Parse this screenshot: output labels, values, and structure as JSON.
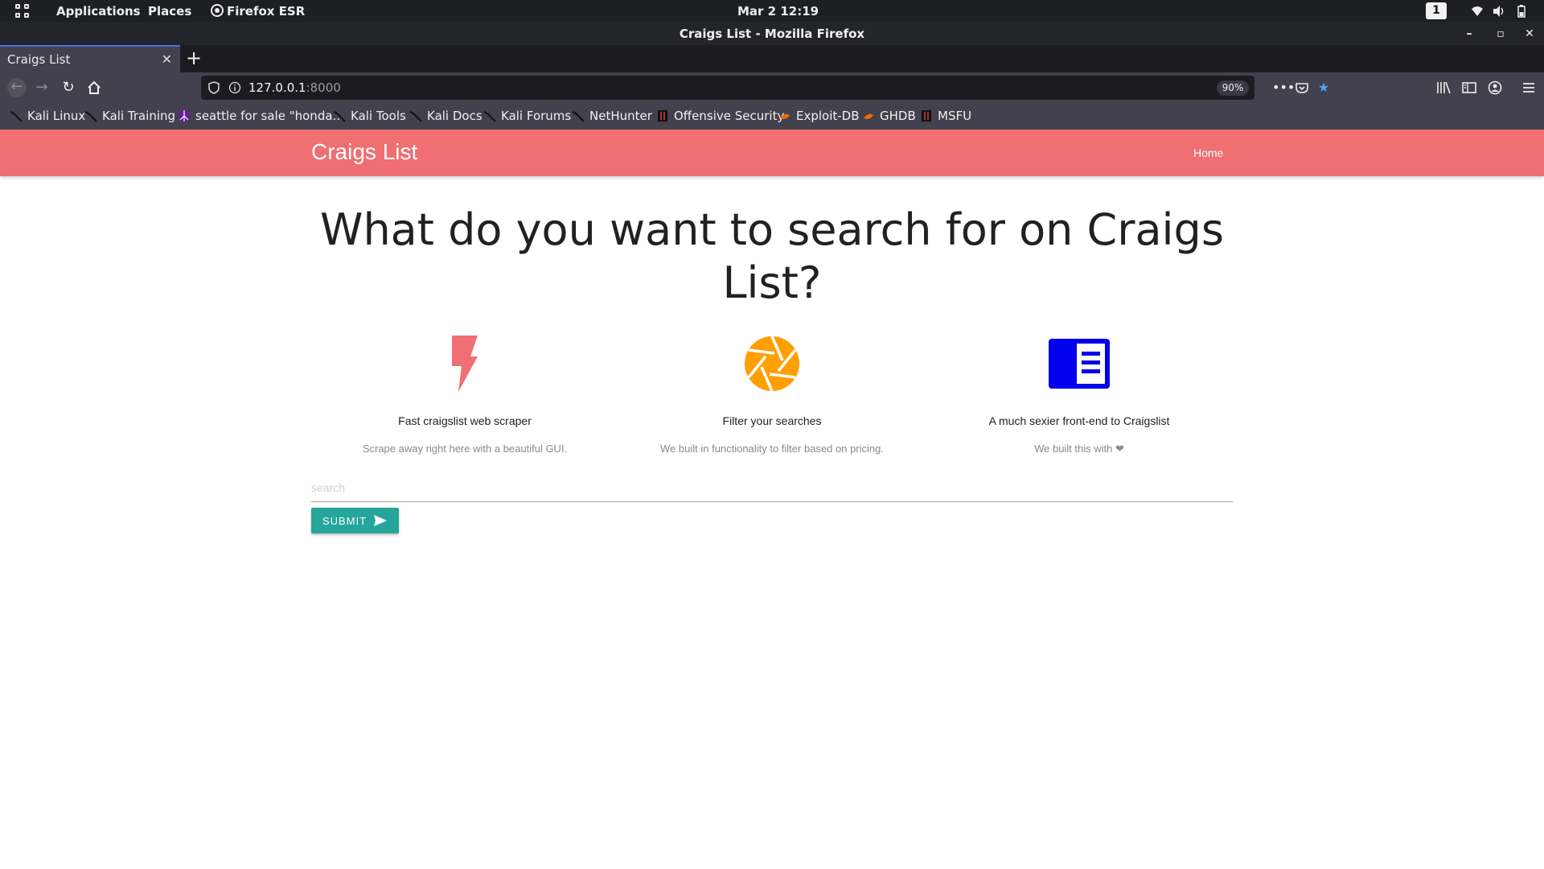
{
  "desktop": {
    "menu_apps": "Applications",
    "menu_places": "Places",
    "menu_firefox": "Firefox ESR",
    "clock": "Mar 2  12:19",
    "workspace": "1"
  },
  "window": {
    "title": "Craigs List - Mozilla Firefox"
  },
  "browser": {
    "tab_label": "Craigs List",
    "url_host": "127.0.0.1",
    "url_port": ":8000",
    "zoom": "90%",
    "bookmarks": [
      {
        "label": "Kali Linux",
        "icon": "kali-dragon-icon"
      },
      {
        "label": "Kali Training",
        "icon": "kali-dragon-icon"
      },
      {
        "label": "seattle for sale \"honda...",
        "icon": "craigslist-peace-icon"
      },
      {
        "label": "Kali Tools",
        "icon": "kali-dragon-icon"
      },
      {
        "label": "Kali Docs",
        "icon": "kali-dragon-icon"
      },
      {
        "label": "Kali Forums",
        "icon": "kali-dragon-icon"
      },
      {
        "label": "NetHunter",
        "icon": "kali-dragon-icon"
      },
      {
        "label": "Offensive Security",
        "icon": "offsec-icon"
      },
      {
        "label": "Exploit-DB",
        "icon": "exploitdb-icon"
      },
      {
        "label": "GHDB",
        "icon": "exploitdb-icon"
      },
      {
        "label": "MSFU",
        "icon": "offsec-icon"
      }
    ]
  },
  "site": {
    "brand": "Craigs List",
    "nav_home": "Home",
    "headline": "What do you want to search for on Craigs List?",
    "features": [
      {
        "icon": "lightning-bolt-icon",
        "color": "#ef6f72",
        "title": "Fast craigslist web scraper",
        "desc": "Scrape away right here with a beautiful GUI."
      },
      {
        "icon": "camera-aperture-icon",
        "color": "#ffa000",
        "title": "Filter your searches",
        "desc": "We built in functionality to filter based on pricing."
      },
      {
        "icon": "chrome-reader-mode-icon",
        "color": "#0000ee",
        "title": "A much sexier front-end to Craigslist",
        "desc": "We built this with ❤"
      }
    ],
    "search_placeholder": "search",
    "submit_label": "SUBMIT"
  },
  "colors": {
    "navbar": "#ef6f72",
    "submit": "#26a69a"
  }
}
